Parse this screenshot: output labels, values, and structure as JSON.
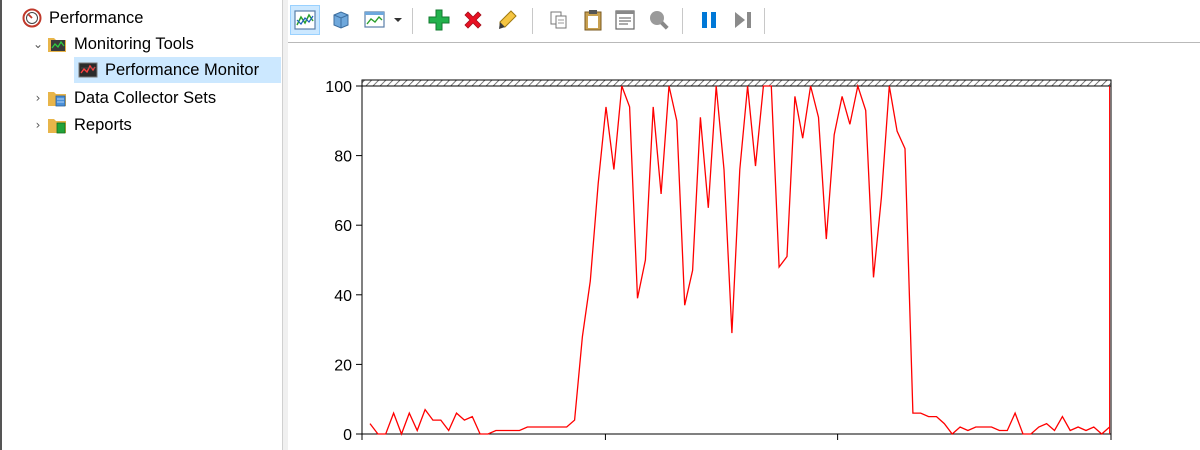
{
  "tree": {
    "root_label": "Performance",
    "monitoring_tools_label": "Monitoring Tools",
    "performance_monitor_label": "Performance Monitor",
    "data_collector_sets_label": "Data Collector Sets",
    "reports_label": "Reports"
  },
  "toolbar": {
    "icons": [
      "view-current-activity-icon",
      "view-log-data-icon",
      "change-graph-type-icon",
      "dropdown-arrow-icon",
      "add-counter-icon",
      "delete-counter-icon",
      "highlight-icon",
      "copy-properties-icon",
      "paste-counter-list-icon",
      "properties-icon",
      "zoom-icon",
      "freeze-display-icon",
      "update-data-icon"
    ]
  },
  "colors": {
    "series": "#ff0000",
    "selection": "#cce8ff",
    "add_green": "#22b14c",
    "delete_red": "#e81123",
    "pause_blue": "#0078d7"
  },
  "chart_data": {
    "type": "line",
    "ylim": [
      0,
      100
    ],
    "y_ticks": [
      0,
      20,
      40,
      60,
      80,
      100
    ],
    "grid": false,
    "series": [
      {
        "values": [
          3,
          0,
          0,
          6,
          0,
          6,
          1,
          7,
          4,
          4,
          1,
          6,
          4,
          5,
          0,
          0,
          1,
          1,
          1,
          1,
          2,
          2,
          2,
          2,
          2,
          2,
          4,
          28,
          44,
          72,
          94,
          76,
          100,
          94,
          39,
          50,
          94,
          69,
          100,
          90,
          37,
          47,
          91,
          65,
          100,
          76,
          29,
          76,
          100,
          77,
          100,
          100,
          48,
          51,
          97,
          85,
          100,
          91,
          56,
          86,
          97,
          89,
          100,
          93,
          45,
          68,
          100,
          87,
          82,
          6,
          6,
          5,
          5,
          3,
          0,
          2,
          1,
          2,
          2,
          2,
          1,
          1,
          6,
          0,
          0,
          2,
          3,
          1,
          5,
          1,
          2,
          1,
          2,
          0,
          2
        ]
      }
    ],
    "current_index": 94
  }
}
